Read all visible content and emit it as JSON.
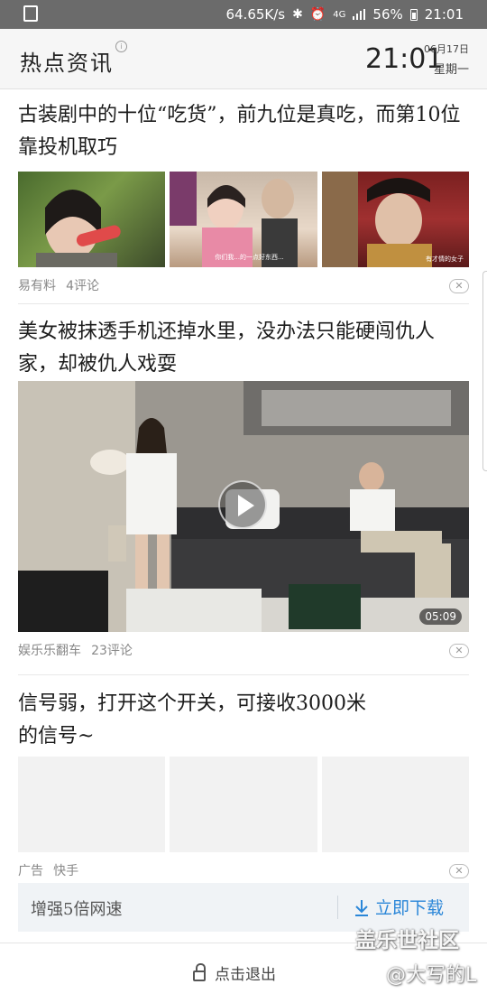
{
  "status_bar": {
    "speed": "64.65K/s",
    "network": "4G",
    "battery": "56%",
    "time": "21:01"
  },
  "header": {
    "title": "热点资讯",
    "info_glyph": "i",
    "clock": "21:01",
    "date": "06月17日",
    "weekday": "星期一"
  },
  "articles": [
    {
      "title": "古装剧中的十位“吃货”，前九位是真吃，而第10位靠投机取巧",
      "source": "易有料",
      "comments": "4评论",
      "thumb_captions": [
        "",
        "你们我...的一点好东西...",
        "有才情的女子"
      ]
    },
    {
      "title": "美女被抹透手机还掉水里，没办法只能硬闯仇人家，却被仇人戏耍",
      "source": "娱乐乐翻车",
      "comments": "23评论",
      "duration": "05:09"
    },
    {
      "title": "信号弱，打开这个开关，可接收3000米的信号~",
      "ad_label": "广告",
      "ad_source": "快手",
      "ad_text": "增强5倍网速",
      "ad_button": "立即下载"
    }
  ],
  "close_glyph": "✕",
  "bottom": {
    "exit_label": "点击退出"
  },
  "watermark": {
    "line1": "盖乐世社区",
    "line2": "@大写的L"
  }
}
